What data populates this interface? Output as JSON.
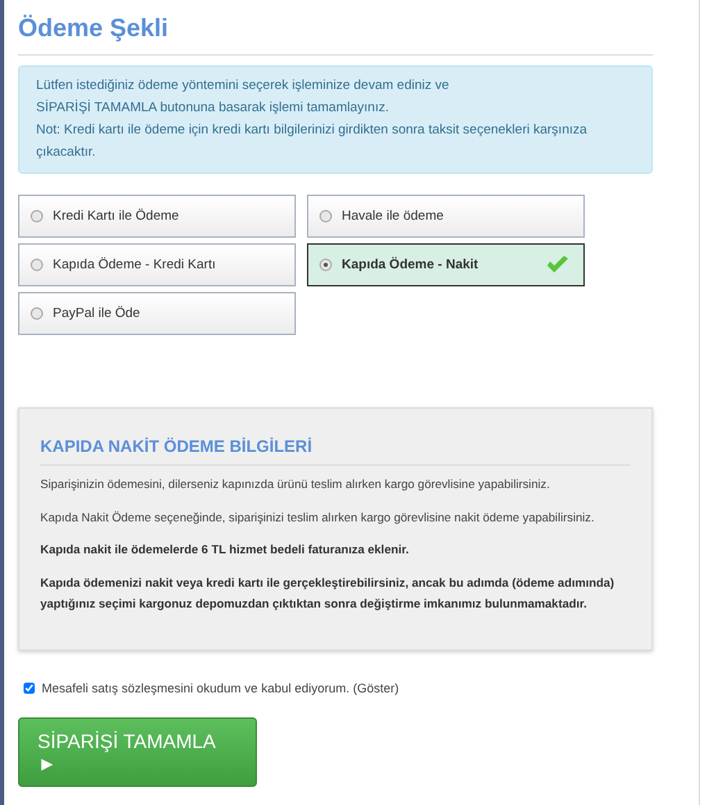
{
  "title": "Ödeme Şekli",
  "notice": [
    "Lütfen istediğiniz ödeme yöntemini seçerek işleminize devam ediniz ve",
    "SİPARİŞİ TAMAMLA butonuna basarak işlemi tamamlayınız.",
    "Not: Kredi kartı ile ödeme için kredi kartı bilgilerinizi girdikten sonra taksit seçenekleri karşınıza çıkacaktır."
  ],
  "payment_options": [
    {
      "label": "Kredi Kartı ile Ödeme",
      "selected": false
    },
    {
      "label": "Havale ile ödeme",
      "selected": false
    },
    {
      "label": "Kapıda Ödeme - Kredi Kartı",
      "selected": false
    },
    {
      "label": "Kapıda Ödeme - Nakit",
      "selected": true
    },
    {
      "label": "PayPal ile Öde",
      "selected": false
    }
  ],
  "info": {
    "heading": "KAPIDA NAKİT ÖDEME BİLGİLERİ",
    "paragraphs": [
      {
        "kind": "plain",
        "text": "Siparişinizin ödemesini, dilerseniz kapınızda ürünü teslim alırken kargo görevlisine yapabilirsiniz."
      },
      {
        "kind": "plain",
        "text": "Kapıda Nakit Ödeme seçeneğinde, siparişinizi teslim alırken kargo görevlisine nakit ödeme yapabilirsiniz."
      },
      {
        "kind": "strong",
        "text": "Kapıda nakit ile ödemelerde 6 TL hizmet bedeli faturanıza eklenir."
      },
      {
        "kind": "strong",
        "text": "Kapıda ödemenizi nakit veya kredi kartı ile gerçekleştirebilirsiniz, ancak bu adımda (ödeme adımında) yaptığınız seçimi kargonuz depomuzdan çıktıktan sonra değiştirme imkanımız bulunmamaktadır."
      }
    ]
  },
  "agreement": {
    "checked": true,
    "label": "Mesafeli satış sözleşmesini okudum ve kabul ediyorum.",
    "link": "(Göster)"
  },
  "submit_button": "SİPARİŞİ TAMAMLA ►"
}
